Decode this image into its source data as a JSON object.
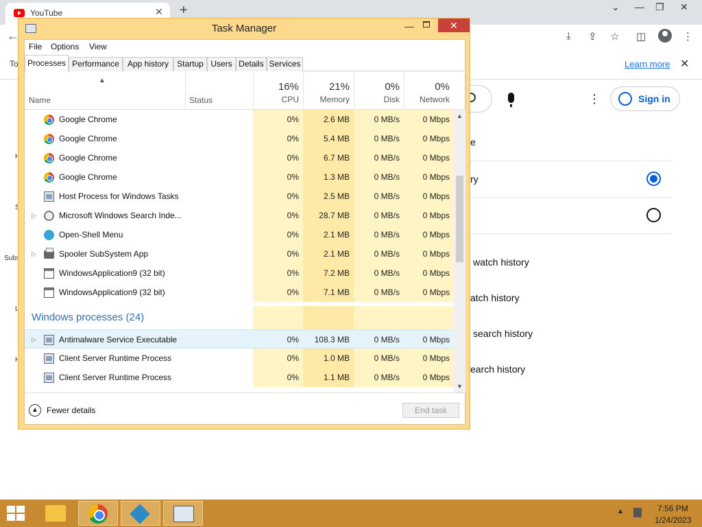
{
  "browser": {
    "tab_title": "YouTube",
    "learn_more": "Learn more",
    "notice_left_fragment": "To",
    "sign_in": "Sign in",
    "left_fragments": [
      "H",
      "S",
      "Subs",
      "L",
      "H"
    ],
    "right_fragments": [
      "e",
      "ry",
      "watch history",
      "atch history",
      "search history",
      "earch history"
    ]
  },
  "task_manager": {
    "title": "Task Manager",
    "menu": [
      "File",
      "Options",
      "View"
    ],
    "tabs": [
      "Processes",
      "Performance",
      "App history",
      "Startup",
      "Users",
      "Details",
      "Services"
    ],
    "active_tab": "Processes",
    "columns": {
      "name": "Name",
      "status": "Status",
      "cpu": {
        "pct": "16%",
        "label": "CPU"
      },
      "memory": {
        "pct": "21%",
        "label": "Memory"
      },
      "disk": {
        "pct": "0%",
        "label": "Disk"
      },
      "network": {
        "pct": "0%",
        "label": "Network"
      }
    },
    "rows": [
      {
        "name": "Google Chrome",
        "icon": "chrome-icon",
        "cpu": "0%",
        "mem": "2.6 MB",
        "disk": "0 MB/s",
        "net": "0 Mbps"
      },
      {
        "name": "Google Chrome",
        "icon": "chrome-icon",
        "cpu": "0%",
        "mem": "5.4 MB",
        "disk": "0 MB/s",
        "net": "0 Mbps"
      },
      {
        "name": "Google Chrome",
        "icon": "chrome-icon",
        "cpu": "0%",
        "mem": "6.7 MB",
        "disk": "0 MB/s",
        "net": "0 Mbps"
      },
      {
        "name": "Google Chrome",
        "icon": "chrome-icon",
        "cpu": "0%",
        "mem": "1.3 MB",
        "disk": "0 MB/s",
        "net": "0 Mbps"
      },
      {
        "name": "Host Process for Windows Tasks",
        "icon": "host-process-icon",
        "cpu": "0%",
        "mem": "2.5 MB",
        "disk": "0 MB/s",
        "net": "0 Mbps"
      },
      {
        "name": "Microsoft Windows Search Inde...",
        "icon": "search-indexer-icon",
        "expand": true,
        "cpu": "0%",
        "mem": "28.7 MB",
        "disk": "0 MB/s",
        "net": "0 Mbps"
      },
      {
        "name": "Open-Shell Menu",
        "icon": "open-shell-icon",
        "cpu": "0%",
        "mem": "2.1 MB",
        "disk": "0 MB/s",
        "net": "0 Mbps"
      },
      {
        "name": "Spooler SubSystem App",
        "icon": "printer-icon",
        "expand": true,
        "cpu": "0%",
        "mem": "2.1 MB",
        "disk": "0 MB/s",
        "net": "0 Mbps"
      },
      {
        "name": "WindowsApplication9 (32 bit)",
        "icon": "window-app-icon",
        "cpu": "0%",
        "mem": "7.2 MB",
        "disk": "0 MB/s",
        "net": "0 Mbps"
      },
      {
        "name": "WindowsApplication9 (32 bit)",
        "icon": "window-app-icon",
        "cpu": "0%",
        "mem": "7.1 MB",
        "disk": "0 MB/s",
        "net": "0 Mbps"
      }
    ],
    "group_header": "Windows processes (24)",
    "rows2": [
      {
        "name": "Antimalware Service Executable",
        "icon": "host-process-icon",
        "expand": true,
        "selected": true,
        "cpu": "0%",
        "mem": "108.3 MB",
        "disk": "0 MB/s",
        "net": "0 Mbps"
      },
      {
        "name": "Client Server Runtime Process",
        "icon": "host-process-icon",
        "cpu": "0%",
        "mem": "1.0 MB",
        "disk": "0 MB/s",
        "net": "0 Mbps"
      },
      {
        "name": "Client Server Runtime Process",
        "icon": "host-process-icon",
        "cpu": "0%",
        "mem": "1.1 MB",
        "disk": "0 MB/s",
        "net": "0 Mbps"
      }
    ],
    "fewer_details": "Fewer details",
    "end_task": "End task"
  },
  "taskbar": {
    "time": "7:56 PM",
    "date": "1/24/2023"
  }
}
